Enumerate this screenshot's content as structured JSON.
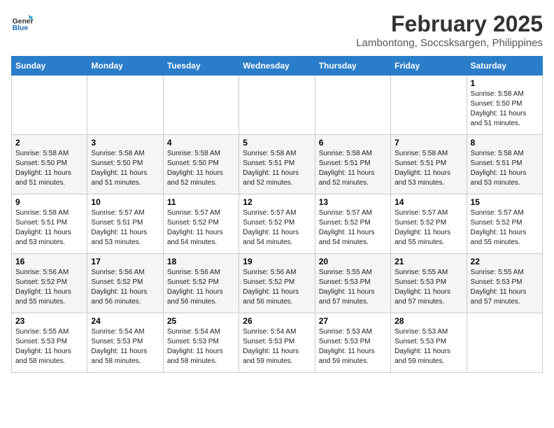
{
  "header": {
    "logo_line1": "General",
    "logo_line2": "Blue",
    "title": "February 2025",
    "subtitle": "Lambontong, Soccsksargen, Philippines"
  },
  "days_of_week": [
    "Sunday",
    "Monday",
    "Tuesday",
    "Wednesday",
    "Thursday",
    "Friday",
    "Saturday"
  ],
  "weeks": [
    [
      {
        "day": "",
        "info": ""
      },
      {
        "day": "",
        "info": ""
      },
      {
        "day": "",
        "info": ""
      },
      {
        "day": "",
        "info": ""
      },
      {
        "day": "",
        "info": ""
      },
      {
        "day": "",
        "info": ""
      },
      {
        "day": "1",
        "info": "Sunrise: 5:58 AM\nSunset: 5:50 PM\nDaylight: 11 hours and 51 minutes."
      }
    ],
    [
      {
        "day": "2",
        "info": "Sunrise: 5:58 AM\nSunset: 5:50 PM\nDaylight: 11 hours and 51 minutes."
      },
      {
        "day": "3",
        "info": "Sunrise: 5:58 AM\nSunset: 5:50 PM\nDaylight: 11 hours and 51 minutes."
      },
      {
        "day": "4",
        "info": "Sunrise: 5:58 AM\nSunset: 5:50 PM\nDaylight: 11 hours and 52 minutes."
      },
      {
        "day": "5",
        "info": "Sunrise: 5:58 AM\nSunset: 5:51 PM\nDaylight: 11 hours and 52 minutes."
      },
      {
        "day": "6",
        "info": "Sunrise: 5:58 AM\nSunset: 5:51 PM\nDaylight: 11 hours and 52 minutes."
      },
      {
        "day": "7",
        "info": "Sunrise: 5:58 AM\nSunset: 5:51 PM\nDaylight: 11 hours and 53 minutes."
      },
      {
        "day": "8",
        "info": "Sunrise: 5:58 AM\nSunset: 5:51 PM\nDaylight: 11 hours and 53 minutes."
      }
    ],
    [
      {
        "day": "9",
        "info": "Sunrise: 5:58 AM\nSunset: 5:51 PM\nDaylight: 11 hours and 53 minutes."
      },
      {
        "day": "10",
        "info": "Sunrise: 5:57 AM\nSunset: 5:51 PM\nDaylight: 11 hours and 53 minutes."
      },
      {
        "day": "11",
        "info": "Sunrise: 5:57 AM\nSunset: 5:52 PM\nDaylight: 11 hours and 54 minutes."
      },
      {
        "day": "12",
        "info": "Sunrise: 5:57 AM\nSunset: 5:52 PM\nDaylight: 11 hours and 54 minutes."
      },
      {
        "day": "13",
        "info": "Sunrise: 5:57 AM\nSunset: 5:52 PM\nDaylight: 11 hours and 54 minutes."
      },
      {
        "day": "14",
        "info": "Sunrise: 5:57 AM\nSunset: 5:52 PM\nDaylight: 11 hours and 55 minutes."
      },
      {
        "day": "15",
        "info": "Sunrise: 5:57 AM\nSunset: 5:52 PM\nDaylight: 11 hours and 55 minutes."
      }
    ],
    [
      {
        "day": "16",
        "info": "Sunrise: 5:56 AM\nSunset: 5:52 PM\nDaylight: 11 hours and 55 minutes."
      },
      {
        "day": "17",
        "info": "Sunrise: 5:56 AM\nSunset: 5:52 PM\nDaylight: 11 hours and 56 minutes."
      },
      {
        "day": "18",
        "info": "Sunrise: 5:56 AM\nSunset: 5:52 PM\nDaylight: 11 hours and 56 minutes."
      },
      {
        "day": "19",
        "info": "Sunrise: 5:56 AM\nSunset: 5:52 PM\nDaylight: 11 hours and 56 minutes."
      },
      {
        "day": "20",
        "info": "Sunrise: 5:55 AM\nSunset: 5:53 PM\nDaylight: 11 hours and 57 minutes."
      },
      {
        "day": "21",
        "info": "Sunrise: 5:55 AM\nSunset: 5:53 PM\nDaylight: 11 hours and 57 minutes."
      },
      {
        "day": "22",
        "info": "Sunrise: 5:55 AM\nSunset: 5:53 PM\nDaylight: 11 hours and 57 minutes."
      }
    ],
    [
      {
        "day": "23",
        "info": "Sunrise: 5:55 AM\nSunset: 5:53 PM\nDaylight: 11 hours and 58 minutes."
      },
      {
        "day": "24",
        "info": "Sunrise: 5:54 AM\nSunset: 5:53 PM\nDaylight: 11 hours and 58 minutes."
      },
      {
        "day": "25",
        "info": "Sunrise: 5:54 AM\nSunset: 5:53 PM\nDaylight: 11 hours and 58 minutes."
      },
      {
        "day": "26",
        "info": "Sunrise: 5:54 AM\nSunset: 5:53 PM\nDaylight: 11 hours and 59 minutes."
      },
      {
        "day": "27",
        "info": "Sunrise: 5:53 AM\nSunset: 5:53 PM\nDaylight: 11 hours and 59 minutes."
      },
      {
        "day": "28",
        "info": "Sunrise: 5:53 AM\nSunset: 5:53 PM\nDaylight: 11 hours and 59 minutes."
      },
      {
        "day": "",
        "info": ""
      }
    ]
  ]
}
